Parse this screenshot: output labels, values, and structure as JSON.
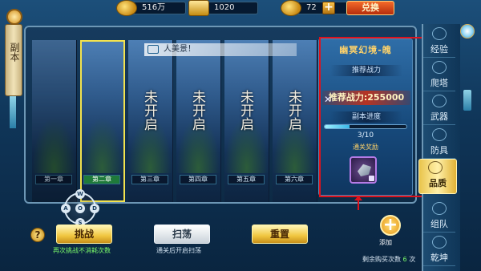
{
  "currency": {
    "silver": "516万",
    "gold_bars": "1020",
    "ingots": "72",
    "exchange_label": "兑换"
  },
  "left_tab": {
    "label": "副本"
  },
  "notice": {
    "text": "人美景！"
  },
  "stages": [
    {
      "cap": "第一章",
      "lock": "",
      "state": "dim"
    },
    {
      "cap": "第二章",
      "lock": "",
      "state": "selected"
    },
    {
      "cap": "第三章",
      "lock": "未开启",
      "state": "locked"
    },
    {
      "cap": "第四章",
      "lock": "未开启",
      "state": "locked"
    },
    {
      "cap": "第五章",
      "lock": "未开启",
      "state": "locked"
    },
    {
      "cap": "第六章",
      "lock": "未开启",
      "state": "locked"
    }
  ],
  "card": {
    "title": "幽冥幻境-魄",
    "recommend_label": "推荐战力",
    "power_text": "推荐战力:255000",
    "progress_label": "副本进度",
    "progress_text": "3/10",
    "progress_fraction": 0.3,
    "reward_label": "通关奖励"
  },
  "right_nav": [
    {
      "label": "经验",
      "active": false
    },
    {
      "label": "爬塔",
      "active": false
    },
    {
      "label": "武器",
      "active": false
    },
    {
      "label": "防具",
      "active": false
    },
    {
      "label": "品质",
      "active": true
    },
    {
      "label": "组队",
      "active": false
    },
    {
      "label": "乾坤",
      "active": false
    }
  ],
  "joystick": {
    "top": "W",
    "left": "A",
    "right": "D",
    "bottom": "S",
    "center": "O"
  },
  "buttons": {
    "help": "?",
    "challenge": "挑战",
    "sweep": "扫荡",
    "reset": "重置"
  },
  "notes": {
    "challenge_note": "再次挑战不消耗次数",
    "sweep_note": "通关后开启扫荡",
    "add_label": "添加",
    "buy_times_prefix": "剩余购买次数",
    "buy_times_value": "6",
    "buy_times_suffix": "次"
  },
  "colors": {
    "accent": "#f3e34e",
    "highlight_red": "#e0121c",
    "gold": "#f0c640"
  }
}
